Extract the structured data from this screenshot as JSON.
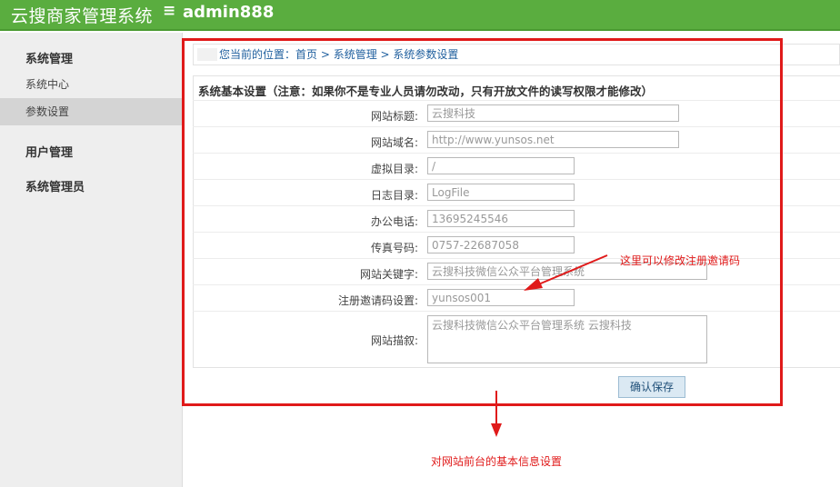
{
  "header": {
    "title": "云搜商家管理系统",
    "menu_icon": "≡",
    "user": "admin888"
  },
  "sidebar": {
    "groups": [
      {
        "label": "系统管理",
        "items": [
          "系统中心",
          "参数设置"
        ]
      },
      {
        "label": "用户管理"
      },
      {
        "label": "系统管理员"
      }
    ],
    "active_item": "参数设置"
  },
  "breadcrumb": {
    "prefix": "您当前的位置：",
    "items": [
      "首页",
      "系统管理",
      "系统参数设置"
    ],
    "separator": " > "
  },
  "form": {
    "section_title": "系统基本设置（注意：如果你不是专业人员请勿改动，只有开放文件的读写权限才能修改）",
    "fields": [
      {
        "label": "网站标题:",
        "value": "云搜科技"
      },
      {
        "label": "网站域名:",
        "value": "http://www.yunsos.net"
      },
      {
        "label": "虚拟目录:",
        "value": "/"
      },
      {
        "label": "日志目录:",
        "value": "LogFile"
      },
      {
        "label": "办公电话:",
        "value": "13695245546"
      },
      {
        "label": "传真号码:",
        "value": "0757-22687058"
      },
      {
        "label": "网站关键字:",
        "value": "云搜科技微信公众平台管理系统"
      },
      {
        "label": "注册邀请码设置:",
        "value": "yunsos001"
      },
      {
        "label": "网站描叙:",
        "value": "云搜科技微信公众平台管理系统 云搜科技"
      }
    ],
    "save_label": "确认保存"
  },
  "annotations": {
    "invite_note": "这里可以修改注册邀请码",
    "bottom_note": "对网站前台的基本信息设置",
    "color": "#e01a1a"
  },
  "colors": {
    "header_bg": "#5aad3f",
    "sidebar_bg": "#eeeeee",
    "link": "#1f5f9e"
  }
}
